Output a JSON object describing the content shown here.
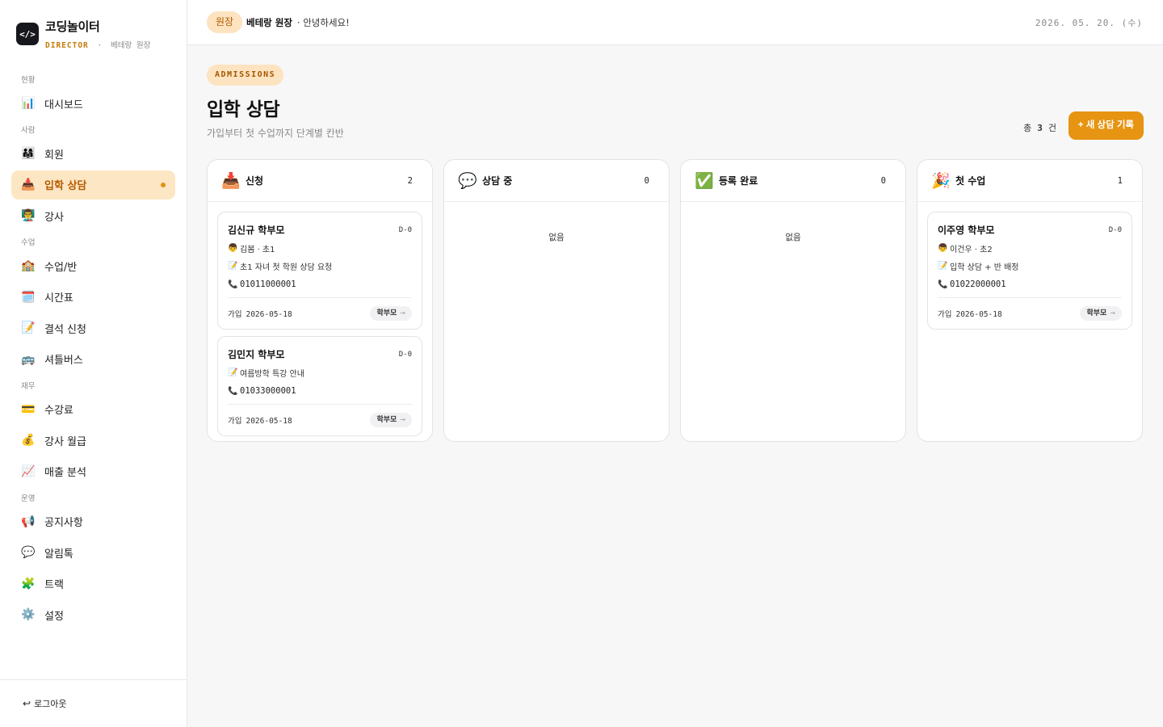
{
  "brand": {
    "logo": "</>",
    "name": "코딩놀이터",
    "role": "DIRECTOR",
    "sep": "·",
    "user": "베테랑 원장"
  },
  "nav": {
    "sections": [
      {
        "title": "현황",
        "items": [
          {
            "icon": "📊",
            "icon_name": "chart-icon",
            "label": "대시보드"
          }
        ]
      },
      {
        "title": "사람",
        "items": [
          {
            "icon": "👨‍👩‍👧",
            "icon_name": "family-icon",
            "label": "회원"
          },
          {
            "icon": "📥",
            "icon_name": "inbox-tray-icon",
            "label": "입학 상담",
            "active": true
          },
          {
            "icon": "👨‍🏫",
            "icon_name": "teacher-icon",
            "label": "강사"
          }
        ]
      },
      {
        "title": "수업",
        "items": [
          {
            "icon": "🏫",
            "icon_name": "school-icon",
            "label": "수업/반"
          },
          {
            "icon": "🗓️",
            "icon_name": "calendar-icon",
            "label": "시간표"
          },
          {
            "icon": "📝",
            "icon_name": "memo-icon",
            "label": "결석 신청"
          },
          {
            "icon": "🚌",
            "icon_name": "bus-icon",
            "label": "셔틀버스"
          }
        ]
      },
      {
        "title": "재무",
        "items": [
          {
            "icon": "💳",
            "icon_name": "credit-card-icon",
            "label": "수강료"
          },
          {
            "icon": "💰",
            "icon_name": "money-bag-icon",
            "label": "강사 월급"
          },
          {
            "icon": "📈",
            "icon_name": "trend-up-icon",
            "label": "매출 분석"
          }
        ]
      },
      {
        "title": "운영",
        "items": [
          {
            "icon": "📢",
            "icon_name": "megaphone-icon",
            "label": "공지사항"
          },
          {
            "icon": "💬",
            "icon_name": "speech-bubble-icon",
            "label": "알림톡"
          },
          {
            "icon": "🧩",
            "icon_name": "puzzle-icon",
            "label": "트랙"
          },
          {
            "icon": "⚙️",
            "icon_name": "gear-icon",
            "label": "설정"
          }
        ]
      }
    ],
    "logout": "로그아웃"
  },
  "header": {
    "role_pill": "원장",
    "user": "베테랑 원장",
    "greeting": "· 안녕하세요!",
    "date": "2026. 05. 20. (수)"
  },
  "page": {
    "tag": "ADMISSIONS",
    "title": "입학 상담",
    "subtitle": "가입부터 첫 수업까지 단계별 칸반",
    "total_prefix": "총",
    "total_count": "3",
    "total_suffix": "건",
    "new_button": "+ 새 상담 기록",
    "empty_label": "없음"
  },
  "columns": [
    {
      "icon": "📥",
      "icon_name": "inbox-tray-icon",
      "title": "신청",
      "count": "2",
      "cards": [
        {
          "name": "김신규 학부모",
          "dday": "D-0",
          "child": "김봄 · 초1",
          "memo": "초1 자녀 첫 학원 상담 요청",
          "phone": "01011000001",
          "joined_label": "가입",
          "joined_date": "2026-05-18",
          "chip": "학부모",
          "chip_arrow": "→"
        },
        {
          "name": "김민지 학부모",
          "dday": "D-0",
          "child": null,
          "memo": "여름방학 특강 안내",
          "phone": "01033000001",
          "joined_label": "가입",
          "joined_date": "2026-05-18",
          "chip": "학부모",
          "chip_arrow": "→"
        }
      ]
    },
    {
      "icon": "💬",
      "icon_name": "speech-bubble-icon",
      "title": "상담 중",
      "count": "0",
      "cards": []
    },
    {
      "icon": "✅",
      "icon_name": "check-mark-icon",
      "title": "등록 완료",
      "count": "0",
      "cards": []
    },
    {
      "icon": "🎉",
      "icon_name": "party-popper-icon",
      "title": "첫 수업",
      "count": "1",
      "cards": [
        {
          "name": "이주영 학부모",
          "dday": "D-0",
          "child": "이건우 · 초2",
          "memo": "입학 상담 + 반 배정",
          "phone": "01022000001",
          "joined_label": "가입",
          "joined_date": "2026-05-18",
          "chip": "학부모",
          "chip_arrow": "→"
        }
      ]
    }
  ],
  "card_icons": {
    "child": "👦",
    "memo": "📝",
    "phone": "📞"
  },
  "colors": {
    "accent": "#e69412",
    "accent_soft": "#fde3c0",
    "active_text": "#b35b00"
  }
}
